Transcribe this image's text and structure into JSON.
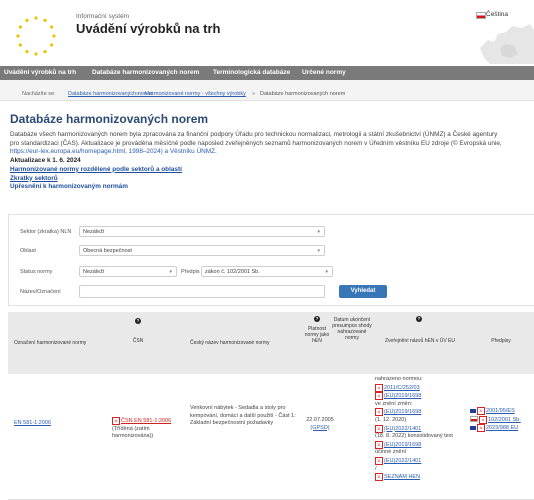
{
  "header": {
    "subtitle": "Informační systém",
    "title": "Uvádění výrobků na trh",
    "language": "Čeština",
    "flag_icon": "czech-flag-icon",
    "logo_icon": "eu-stars-icon",
    "map_icon": "europe-map-icon"
  },
  "nav": {
    "items": [
      "Uvádění výrobků na trh",
      "Databáze harmonizovaných norem",
      "Terminologická databáze",
      "Určené normy"
    ]
  },
  "breadcrumb": {
    "prefix": "Nacházíte se:",
    "items": [
      "Databáze harmonizovaných norem",
      "Harmonizované normy - všechny výrobky",
      "Databáze harmonizovaných norem"
    ],
    "separator": "»"
  },
  "page": {
    "title": "Databáze harmonizovaných norem",
    "intro": [
      "Databáze všech harmonizovaných norem byla zpracována za finanční podpory Úřadu pro technickou normalizaci, metrologii a státní zkušebnictví (ÚNMZ) a České agentury",
      "pro standardizaci (ČAS). Aktualizace je prováděna měsíčně podle naposled zveřejněných seznamů harmonizovaných norem v Úředním věstníku EU zdroje (© Evropská unie,",
      "https://eur-lex.europa.eu/homepage.html, 1998–2024) a Věstníku ÚNMZ."
    ],
    "update": "Aktualizace k 1. 6. 2024",
    "links": [
      "Harmonizované normy rozdělené podle sektorů a oblastí",
      "Zkratky sektorů",
      "Upřesnění k harmonizovaným normám"
    ]
  },
  "filter": {
    "sector_label": "Sektor (zkratka) NLN",
    "sector_value": "Nezáleží",
    "area_label": "Oblast",
    "area_value": "Obecná bezpečnost",
    "status_label": "Status normy",
    "status_value": "Nezáleží",
    "regulation_label": "Předpis",
    "regulation_value": "zákon č. 102/2001 Sb.",
    "name_label": "Název/Označení",
    "name_value": "",
    "search_button": "Vyhledat"
  },
  "table": {
    "headers": [
      "Označení harmonizované normy",
      "ČSN",
      "Český název harmonizované normy",
      "Platnost normy jako hEN",
      "Datum ukončení presumpce shody nahrazované normy",
      "Zveřejnění názvů hEN v ÚV EU",
      "Předpisy"
    ],
    "rows": [
      {
        "designation": "EN 581-1:2006",
        "csn": "ČSN EN 581-1:2006",
        "csn_note": "(Tříděná (zatím harmonizována))",
        "name": "Venkovní nábytek - Sedadla a stoly pro kempování, domácí a další použití - Část 1: Základní bezpečnostní požadavky",
        "validity": "22.07.2005",
        "validity_note": "(GPSD)",
        "publication": [
          "nahrazeno normou:",
          "2011/C/252/03",
          "(EU)2019/1698",
          "ve znění změn:",
          "(EU)2019/1698",
          "(1. 12. 2020)",
          "(EU)2022/1401",
          "(18. 8. 2022) konsolidovaný text",
          "(EU)2019/1698",
          "účinné znění",
          "(EU)2022/1401",
          "/",
          "SEZNAM HEN"
        ],
        "regulations": [
          "2001/95/ES",
          "102/2001 Sb.",
          "2023/988 EU"
        ],
        "regulation_flags": [
          "eu-flag-icon",
          "czech-flag-icon",
          "eu-flag-icon"
        ]
      }
    ]
  },
  "colors": {
    "nav_bg": "#7a7a7a",
    "title": "#2b4a73",
    "link": "#2a5db0",
    "button": "#3876b8",
    "table_header_bg": "#e9e9e9",
    "pdf_red": "#cc2222"
  }
}
